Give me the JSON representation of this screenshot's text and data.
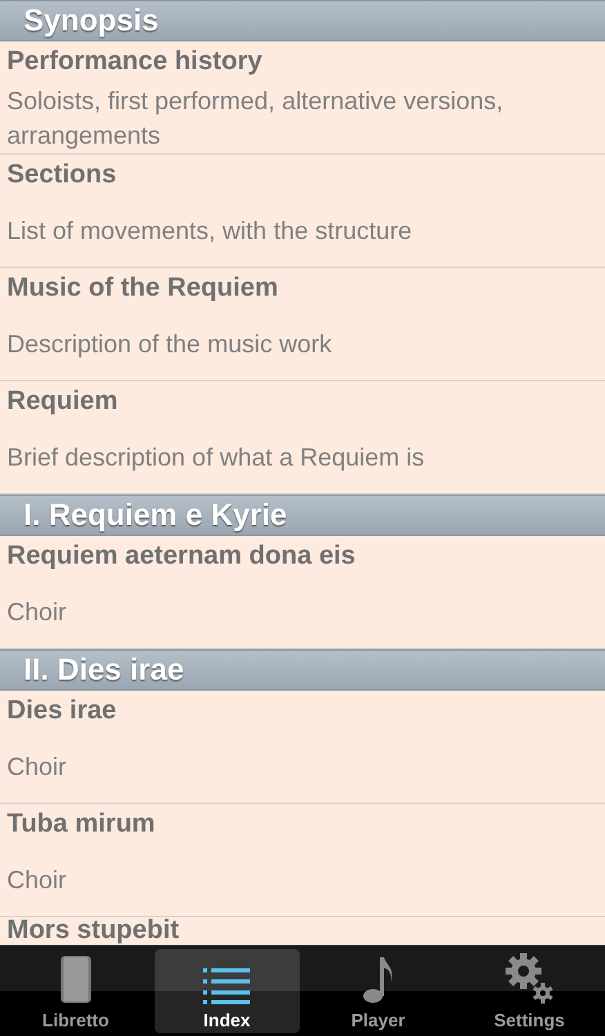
{
  "sections": [
    {
      "title": "Synopsis",
      "rows": [
        {
          "title": "Performance history",
          "subtitle": "Soloists, first performed, alternative versions, arrangements"
        },
        {
          "title": "Sections",
          "subtitle": "List of movements, with the structure"
        },
        {
          "title": "Music of the Requiem",
          "subtitle": "Description of the music work"
        },
        {
          "title": "Requiem",
          "subtitle": "Brief description of what a Requiem is"
        }
      ]
    },
    {
      "title": "I. Requiem e Kyrie",
      "rows": [
        {
          "title": "Requiem aeternam dona eis",
          "subtitle": "Choir"
        }
      ]
    },
    {
      "title": "II. Dies irae",
      "rows": [
        {
          "title": "Dies irae",
          "subtitle": "Choir"
        },
        {
          "title": "Tuba mirum",
          "subtitle": "Choir"
        },
        {
          "title": "Mors stupebit"
        }
      ]
    }
  ],
  "tabs": [
    {
      "label": "Libretto",
      "kind": "book",
      "selected": false
    },
    {
      "label": "Index",
      "kind": "list",
      "selected": true
    },
    {
      "label": "Player",
      "kind": "note",
      "selected": false
    },
    {
      "label": "Settings",
      "kind": "gear",
      "selected": false
    }
  ]
}
